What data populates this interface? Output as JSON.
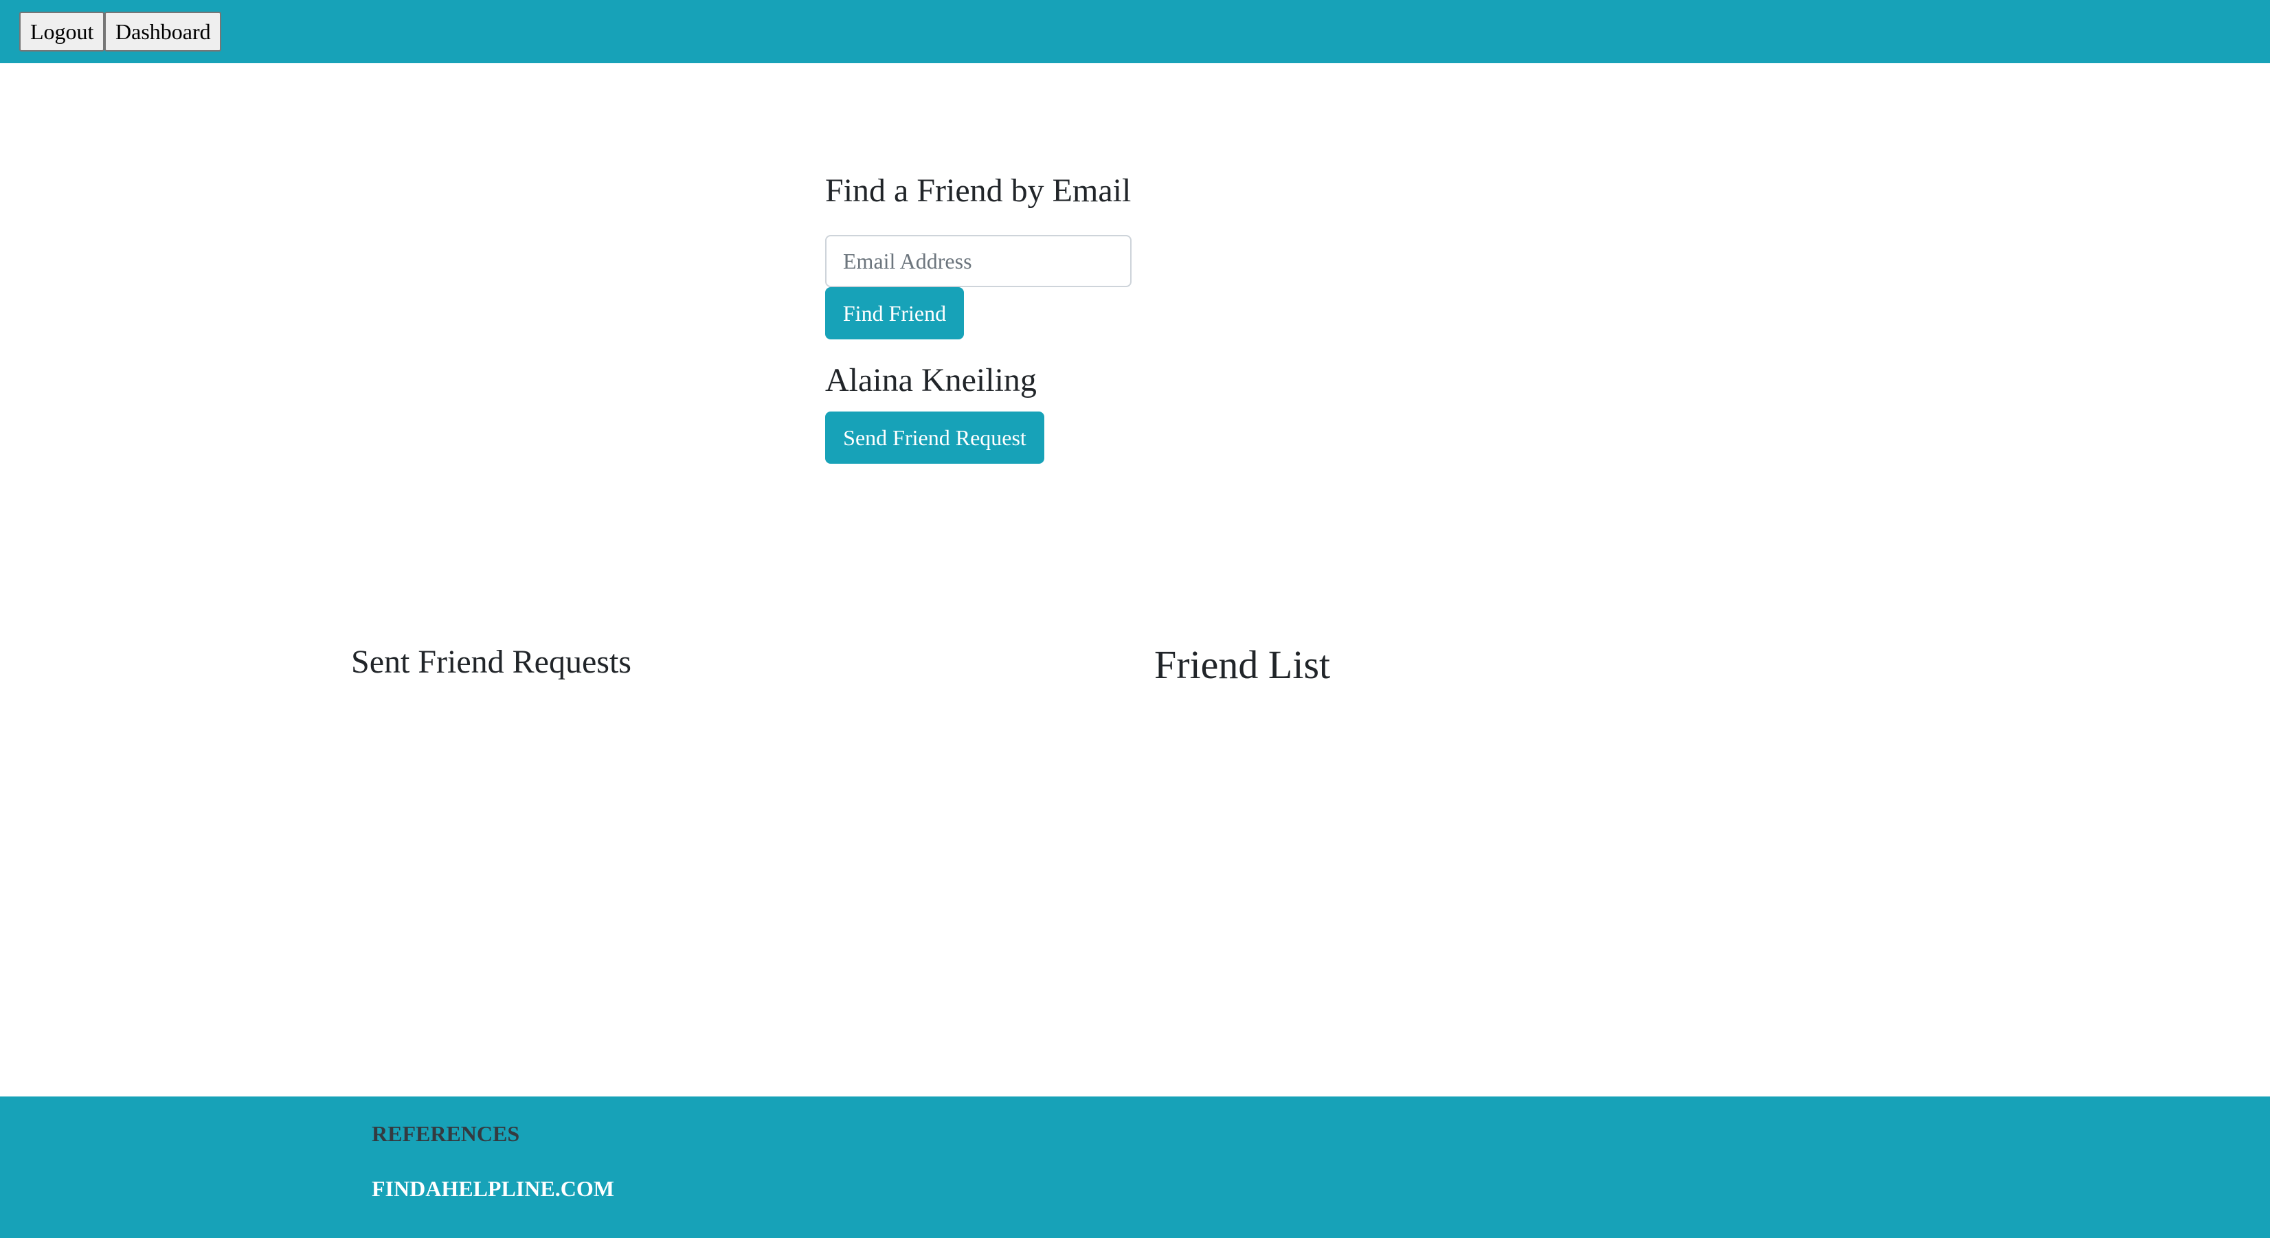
{
  "nav": {
    "logout_label": "Logout",
    "dashboard_label": "Dashboard"
  },
  "find_friend": {
    "title": "Find a Friend by Email",
    "email_placeholder": "Email Address",
    "email_value": "",
    "find_button_label": "Find Friend"
  },
  "search_result": {
    "name": "Alaina Kneiling",
    "send_request_label": "Send Friend Request"
  },
  "sent_requests": {
    "title": "Sent Friend Requests",
    "items": []
  },
  "friend_list": {
    "title": "Friend List",
    "items": []
  },
  "footer": {
    "heading": "REFERENCES",
    "link_label": "FINDAHELPLINE.COM"
  },
  "colors": {
    "accent": "#17a2b8",
    "footer_heading": "#343a40",
    "text": "#212529"
  }
}
